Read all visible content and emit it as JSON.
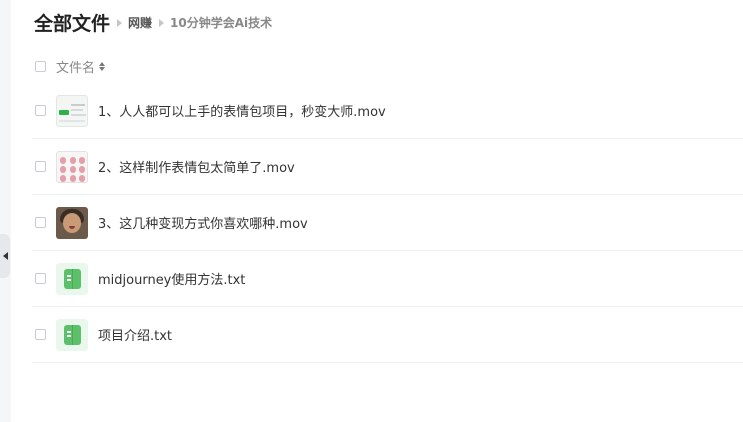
{
  "breadcrumb": {
    "root": "全部文件",
    "items": [
      "网赚",
      "10分钟学会Ai技术"
    ]
  },
  "list_header": {
    "name_column": "文件名"
  },
  "files": [
    {
      "name": "1、人人都可以上手的表情包项目，秒变大师.mov",
      "type": "video",
      "thumbnail": "screen-recording"
    },
    {
      "name": "2、这样制作表情包太简单了.mov",
      "type": "video",
      "thumbnail": "emoji-sheet"
    },
    {
      "name": "3、这几种变现方式你喜欢哪种.mov",
      "type": "video",
      "thumbnail": "portrait"
    },
    {
      "name": "midjourney使用方法.txt",
      "type": "txt",
      "thumbnail": "txt-file-icon"
    },
    {
      "name": "项目介绍.txt",
      "type": "txt",
      "thumbnail": "txt-file-icon"
    }
  ],
  "colors": {
    "txt_icon": "#5cbf6a",
    "txt_icon_bg": "#eaf7ec"
  }
}
